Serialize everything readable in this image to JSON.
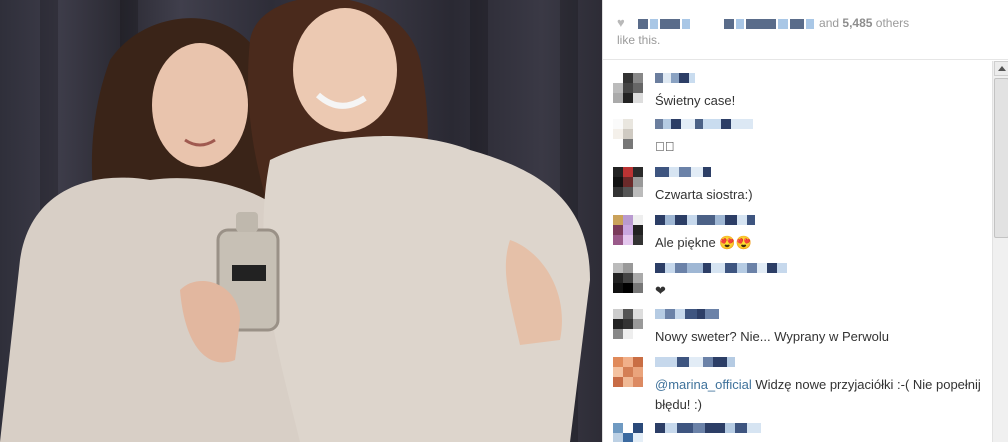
{
  "likes": {
    "heart_icon": "heart-icon",
    "and_text": "and",
    "count": "5,485",
    "others_text": "others",
    "line2": "like this."
  },
  "comments": [
    {
      "text": "Świetny case!"
    },
    {
      "text": "❤🏻"
    },
    {
      "text": "Czwarta siostra:)"
    },
    {
      "text": "Ale piękne 😍😍"
    },
    {
      "text": "❤"
    },
    {
      "text": "Nowy sweter? Nie... Wyprany w Perwolu"
    },
    {
      "username_partial": "kolorowadaka",
      "mention": "@marina_official",
      "text": " Widzę nowe przyjaciółki :-( Nie popełnij błędu! :)"
    },
    {
      "text": ""
    }
  ]
}
